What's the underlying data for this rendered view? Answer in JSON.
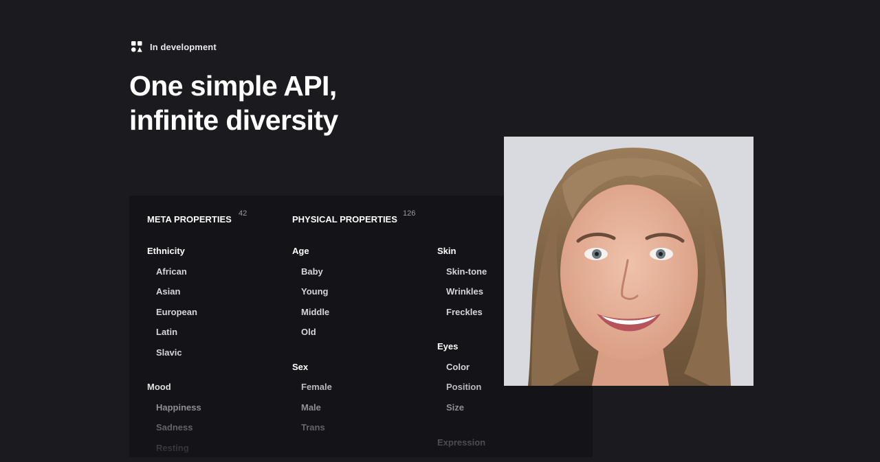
{
  "status": {
    "label": "In development"
  },
  "headline": {
    "line1": "One simple API,",
    "line2": "infinite diversity"
  },
  "properties": {
    "meta": {
      "title": "META PROPERTIES",
      "count": "42",
      "groups": [
        {
          "title": "Ethnicity",
          "items": [
            "African",
            "Asian",
            "European",
            "Latin",
            "Slavic"
          ]
        },
        {
          "title": "Mood",
          "items": [
            "Happiness",
            "Sadness",
            "Resting"
          ]
        }
      ]
    },
    "physical": {
      "title": "PHYSICAL PROPERTIES",
      "count": "126",
      "groups": [
        {
          "title": "Age",
          "items": [
            "Baby",
            "Young",
            "Middle",
            "Old"
          ]
        },
        {
          "title": "Sex",
          "items": [
            "Female",
            "Male",
            "Trans"
          ]
        },
        {
          "title": "Skin",
          "items": [
            "Skin-tone",
            "Wrinkles",
            "Freckles"
          ]
        },
        {
          "title": "Eyes",
          "items": [
            "Color",
            "Position",
            "Size"
          ]
        },
        {
          "title": "Expression",
          "items": []
        }
      ]
    }
  },
  "colors": {
    "background": "#1b1a1f",
    "panel": "#141318",
    "text_primary": "#ffffff",
    "text_secondary": "#d6d5dc"
  },
  "icons": {
    "status": "grid-shapes-icon"
  }
}
